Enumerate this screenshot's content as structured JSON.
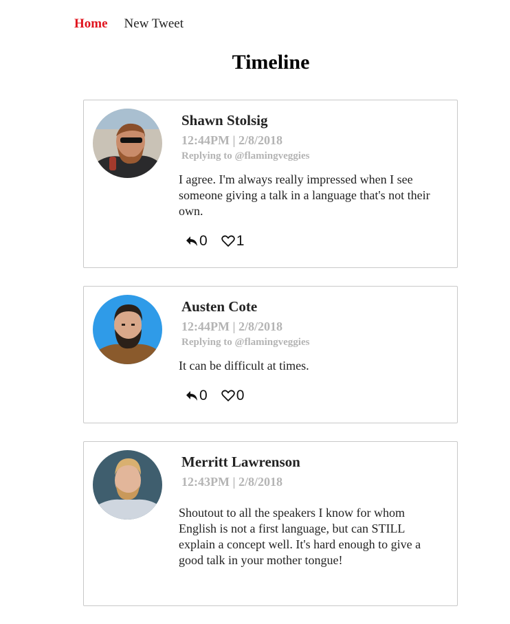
{
  "nav": {
    "home_label": "Home",
    "new_tweet_label": "New Tweet"
  },
  "page": {
    "title": "Timeline"
  },
  "tweets": [
    {
      "author": "Shawn Stolsig",
      "timestamp": "12:44PM | 2/8/2018",
      "reply_to": "Replying to @flamingveggies",
      "text": "I agree. I'm always really impressed when I see someone giving a talk in a language that's not their own.",
      "reply_count": "0",
      "like_count": "1"
    },
    {
      "author": "Austen Cote",
      "timestamp": "12:44PM | 2/8/2018",
      "reply_to": "Replying to @flamingveggies",
      "text": "It can be difficult at times.",
      "reply_count": "0",
      "like_count": "0"
    },
    {
      "author": "Merritt Lawrenson",
      "timestamp": "12:43PM | 2/8/2018",
      "reply_to": "",
      "text": "Shoutout to all the speakers I know for whom English is not a first language, but can STILL explain a concept well. It's hard enough to give a good talk in your mother tongue!",
      "reply_count": "",
      "like_count": ""
    }
  ],
  "colors": {
    "active_nav": "#e0141e",
    "meta_text": "#b4b4b4",
    "card_border": "#c8c8c8"
  },
  "icons": {
    "reply": "reply-arrow-icon",
    "like": "heart-outline-icon"
  }
}
